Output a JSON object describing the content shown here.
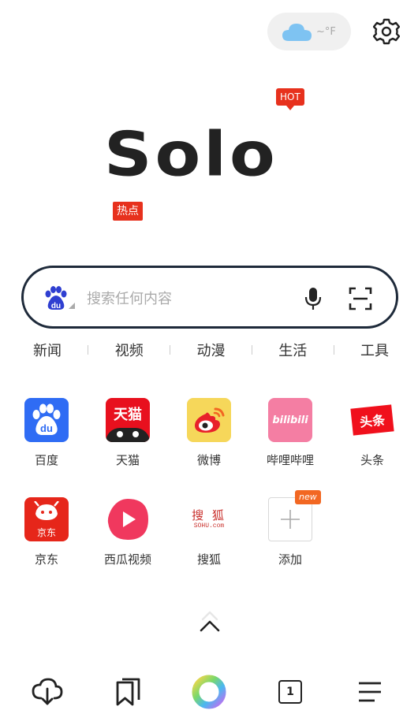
{
  "weather": {
    "temp": "~°F",
    "icon": "cloud-icon",
    "color": "#7ec3f2"
  },
  "header": {
    "settings_icon": "gear-icon"
  },
  "logo": {
    "text": "Solo",
    "hot_badge": "HOT",
    "hot_tag": "热点"
  },
  "search": {
    "placeholder": "搜索任何内容",
    "engine": "du",
    "mic_icon": "microphone-icon",
    "scan_icon": "scan-icon"
  },
  "categories": [
    "新闻",
    "视频",
    "动漫",
    "生活",
    "工具"
  ],
  "shortcuts": [
    {
      "label": "百度",
      "icon": "baidu-icon",
      "color": "#2f6cf4",
      "text": "du"
    },
    {
      "label": "天猫",
      "icon": "tmall-icon",
      "color": "#e8101e",
      "text": "天猫"
    },
    {
      "label": "微博",
      "icon": "weibo-icon",
      "color": "#f6d75a",
      "text": ""
    },
    {
      "label": "哔哩哔哩",
      "icon": "bilibili-icon",
      "color": "#f47ea3",
      "text": "bilibili"
    },
    {
      "label": "头条",
      "icon": "toutiao-icon",
      "color": "#f0101c",
      "text": "头条"
    },
    {
      "label": "京东",
      "icon": "jd-icon",
      "color": "#e6261a",
      "text": "京东"
    },
    {
      "label": "西瓜视频",
      "icon": "xigua-video-icon",
      "color": "#f0385e",
      "text": ""
    },
    {
      "label": "搜狐",
      "icon": "sohu-icon",
      "color": "#c9302c",
      "text": "搜 狐",
      "subtext": "SOHU.com"
    },
    {
      "label": "添加",
      "icon": "add-icon",
      "color": "#cccccc",
      "text": ""
    }
  ],
  "new_badge": "new",
  "bottom_bar": {
    "tab_count": "1",
    "icons": [
      "download-cloud-icon",
      "bookmark-icon",
      "home-orb-icon",
      "tabs-icon",
      "menu-icon"
    ]
  }
}
